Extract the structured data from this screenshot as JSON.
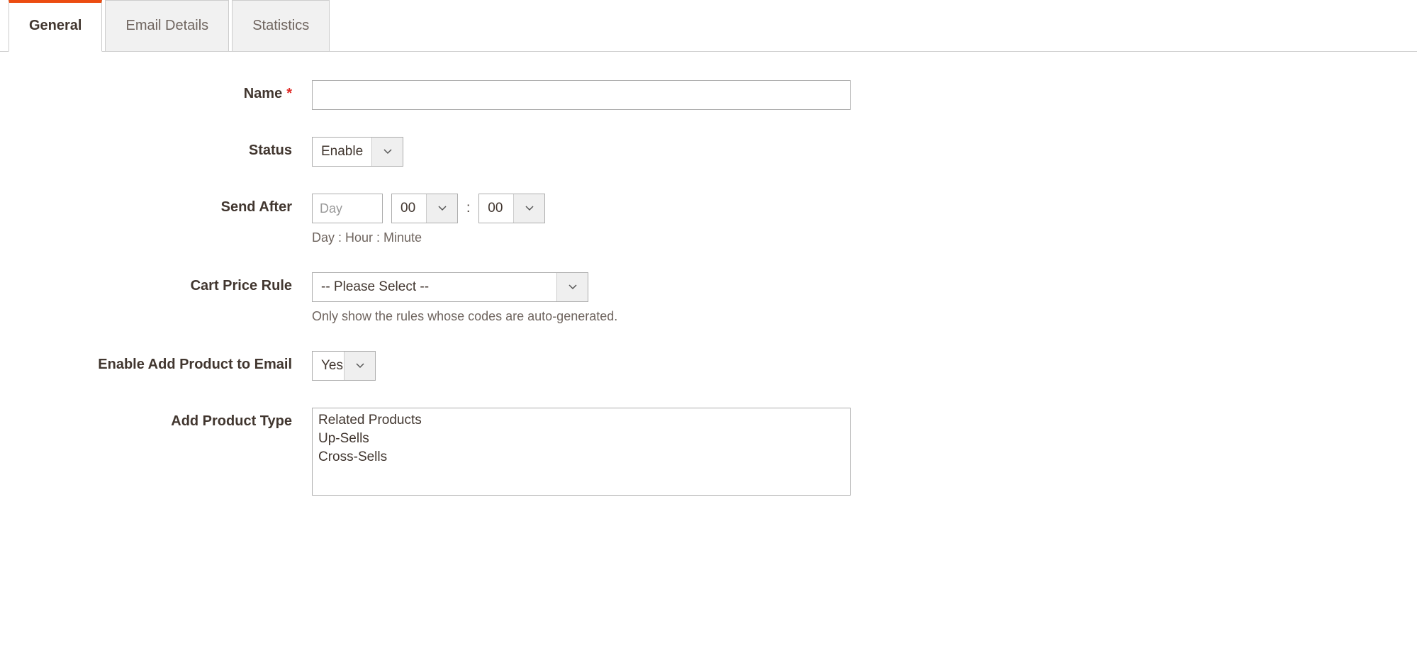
{
  "tabs": {
    "general": "General",
    "email_details": "Email Details",
    "statistics": "Statistics"
  },
  "fields": {
    "name": {
      "label": "Name",
      "value": ""
    },
    "status": {
      "label": "Status",
      "selected": "Enable"
    },
    "send_after": {
      "label": "Send After",
      "day_placeholder": "Day",
      "hour_selected": "00",
      "minute_selected": "00",
      "help": "Day : Hour : Minute"
    },
    "cart_price_rule": {
      "label": "Cart Price Rule",
      "selected": "-- Please Select --",
      "help": "Only show the rules whose codes are auto-generated."
    },
    "enable_add_product": {
      "label": "Enable Add Product to Email",
      "selected": "Yes"
    },
    "add_product_type": {
      "label": "Add Product Type",
      "options": {
        "related": "Related Products",
        "upsells": "Up-Sells",
        "crosssells": "Cross-Sells"
      }
    }
  }
}
